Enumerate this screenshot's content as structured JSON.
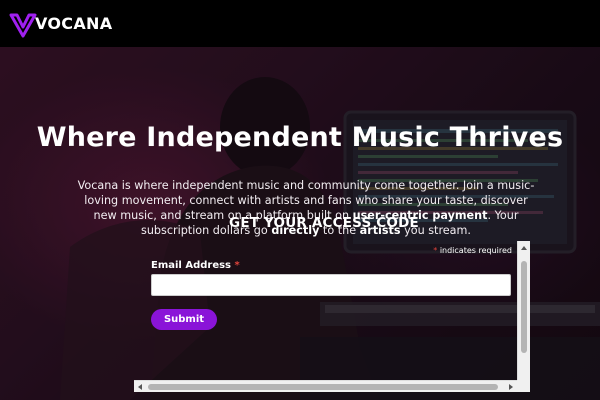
{
  "brand": {
    "logo_text": "VOCANA",
    "accent": "#8a14d8",
    "logo_mark_color": "#a020f0"
  },
  "hero": {
    "title": "Where Independent Music Thrives",
    "desc_1": "Vocana is where independent music and community come together. Join a music-loving movement, connect with artists and fans who share your taste, discover new music, and stream on a platform built on ",
    "desc_bold_1": "user-centric payment",
    "desc_2": ". Your subscription dollars go ",
    "desc_bold_2": "directly",
    "desc_3": " to the ",
    "desc_bold_3": "artists",
    "desc_4": " you stream."
  },
  "form": {
    "title": "GET YOUR ACCESS CODE",
    "required_asterisk": "*",
    "required_note": "indicates required",
    "email_label": "Email Address",
    "email_asterisk": "*",
    "email_value": "",
    "submit_label": "Submit",
    "submit_color": "#8a14d8"
  }
}
